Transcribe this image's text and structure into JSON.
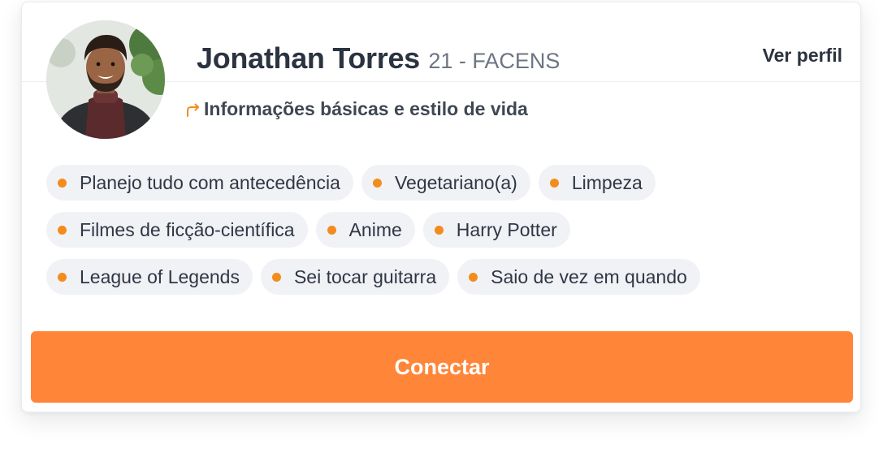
{
  "profile": {
    "name": "Jonathan Torres",
    "meta": "21 - FACENS",
    "view_profile_label": "Ver perfil",
    "section_title": "Informações básicas e estilo de vida",
    "section_icon": "arrow-turn-right-icon"
  },
  "tags": [
    [
      "Planejo tudo com antecedência",
      "Vegetariano(a)",
      "Limpeza"
    ],
    [
      "Filmes de ficção-científica",
      "Anime",
      "Harry Potter"
    ],
    [
      "League of Legends",
      "Sei tocar guitarra",
      "Saio de vez em quando"
    ]
  ],
  "connect_label": "Conectar",
  "colors": {
    "accent": "#ff8638",
    "dot": "#f28c1c",
    "tag_bg": "#f1f2f6",
    "text_dark": "#2b3340"
  }
}
